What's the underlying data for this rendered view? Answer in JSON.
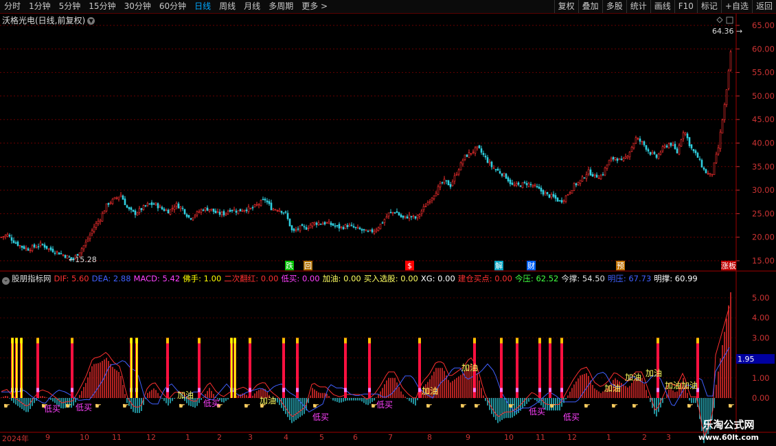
{
  "toolbar": {
    "periods": [
      "分时",
      "1分钟",
      "5分钟",
      "15分钟",
      "30分钟",
      "60分钟",
      "日线",
      "周线",
      "月线",
      "多周期",
      "更多 >"
    ],
    "active": "日线",
    "right": [
      "复权",
      "叠加",
      "多股",
      "统计",
      "画线",
      "F10",
      "标记",
      "+自选",
      "返回"
    ]
  },
  "stock": {
    "title": "沃格光电(日线,前复权)"
  },
  "main_chart": {
    "y_ticks": [
      "65.00",
      "60.00",
      "55.00",
      "50.00",
      "45.00",
      "40.00",
      "35.00",
      "30.00",
      "25.00",
      "20.00",
      "15.00"
    ],
    "high_label": "64.36",
    "low_label": "15.28",
    "event_markers": [
      {
        "text": "跌",
        "color": "#00c000"
      },
      {
        "text": "回",
        "color": "#b07000"
      },
      {
        "text": "$",
        "color": "#ff0000"
      },
      {
        "text": "解",
        "color": "#00a0c0"
      },
      {
        "text": "财",
        "color": "#0060ff"
      },
      {
        "text": "预",
        "color": "#c07000"
      },
      {
        "text": "涨板",
        "color": "#c00000"
      }
    ]
  },
  "indicator": {
    "name": "股朋指标网",
    "fields": [
      {
        "label": "DIF: 5.60",
        "color": "#ff3030"
      },
      {
        "label": "DEA: 2.88",
        "color": "#4060ff"
      },
      {
        "label": "MACD: 5.42",
        "color": "#ff40ff"
      },
      {
        "label": "佛手: 1.00",
        "color": "#ffff00"
      },
      {
        "label": "二次翻红: 0.00",
        "color": "#ff3030"
      },
      {
        "label": "低买: 0.00",
        "color": "#ff40ff"
      },
      {
        "label": "加油: 0.00",
        "color": "#ffff60"
      },
      {
        "label": "买入选股: 0.00",
        "color": "#ffff60"
      },
      {
        "label": "XG: 0.00",
        "color": "#ffffff"
      },
      {
        "label": "建仓买点: 0.00",
        "color": "#ff3030"
      },
      {
        "label": "今压: 62.52",
        "color": "#40ff40"
      },
      {
        "label": "今撑: 54.50",
        "color": "#e0e0e0"
      },
      {
        "label": "明压: 67.73",
        "color": "#4060ff"
      },
      {
        "label": "明撑: 60.99",
        "color": "#ffffff"
      }
    ],
    "y_ticks": [
      "5.00",
      "4.00",
      "3.00",
      "2.00",
      "1.00",
      "0.00"
    ],
    "current_value": "1.95",
    "signal_labels": [
      "低买",
      "低买",
      "加油",
      "低买",
      "加油",
      "低买",
      "低买",
      "加油",
      "加油",
      "低买",
      "低买",
      "加油",
      "加油",
      "加油",
      "加油",
      "加油"
    ]
  },
  "date_axis": [
    "2024年",
    "9",
    "10",
    "11",
    "12",
    "1",
    "2",
    "3",
    "4",
    "5",
    "6",
    "7",
    "8",
    "9",
    "10",
    "11",
    "12",
    "1",
    "2",
    "3"
  ],
  "watermark": {
    "line1": "乐淘公式网",
    "line2": "www.60lt.com"
  },
  "chart_data": {
    "type": "candlestick",
    "title": "沃格光电(日线,前复权)",
    "ylim": [
      13,
      67
    ],
    "price_path": [
      [
        0,
        20
      ],
      [
        10,
        20.5
      ],
      [
        20,
        19
      ],
      [
        30,
        18
      ],
      [
        40,
        17.5
      ],
      [
        50,
        18
      ],
      [
        60,
        18.5
      ],
      [
        70,
        17.5
      ],
      [
        80,
        17
      ],
      [
        95,
        16
      ],
      [
        105,
        15.28
      ],
      [
        115,
        17
      ],
      [
        125,
        19
      ],
      [
        135,
        22
      ],
      [
        145,
        24
      ],
      [
        155,
        27
      ],
      [
        165,
        28
      ],
      [
        175,
        29
      ],
      [
        185,
        26
      ],
      [
        195,
        25
      ],
      [
        205,
        26
      ],
      [
        215,
        27
      ],
      [
        225,
        27
      ],
      [
        235,
        26
      ],
      [
        245,
        25.5
      ],
      [
        255,
        27
      ],
      [
        265,
        26
      ],
      [
        275,
        24
      ],
      [
        285,
        25
      ],
      [
        295,
        26
      ],
      [
        305,
        26
      ],
      [
        315,
        25
      ],
      [
        325,
        25
      ],
      [
        335,
        26
      ],
      [
        345,
        25.5
      ],
      [
        355,
        26
      ],
      [
        365,
        26
      ],
      [
        375,
        27
      ],
      [
        385,
        28
      ],
      [
        395,
        26
      ],
      [
        405,
        26
      ],
      [
        415,
        25
      ],
      [
        425,
        21
      ],
      [
        435,
        22
      ],
      [
        445,
        22
      ],
      [
        455,
        23
      ],
      [
        465,
        23
      ],
      [
        475,
        23
      ],
      [
        485,
        22.5
      ],
      [
        495,
        22
      ],
      [
        505,
        22.5
      ],
      [
        515,
        22
      ],
      [
        525,
        21.5
      ],
      [
        535,
        21
      ],
      [
        545,
        21.5
      ],
      [
        555,
        23
      ],
      [
        565,
        25
      ],
      [
        575,
        25.5
      ],
      [
        585,
        24
      ],
      [
        595,
        24.5
      ],
      [
        605,
        24
      ],
      [
        615,
        26
      ],
      [
        625,
        28
      ],
      [
        635,
        30
      ],
      [
        645,
        32
      ],
      [
        655,
        31
      ],
      [
        665,
        34
      ],
      [
        675,
        37
      ],
      [
        685,
        38
      ],
      [
        695,
        39
      ],
      [
        705,
        37
      ],
      [
        715,
        35
      ],
      [
        725,
        34
      ],
      [
        735,
        33
      ],
      [
        745,
        31
      ],
      [
        755,
        31
      ],
      [
        765,
        31.5
      ],
      [
        775,
        31
      ],
      [
        785,
        30
      ],
      [
        795,
        29
      ],
      [
        805,
        28.5
      ],
      [
        815,
        27.5
      ],
      [
        825,
        29
      ],
      [
        835,
        31
      ],
      [
        845,
        32
      ],
      [
        855,
        34
      ],
      [
        865,
        33
      ],
      [
        875,
        33
      ],
      [
        885,
        36
      ],
      [
        895,
        37
      ],
      [
        905,
        36
      ],
      [
        915,
        38
      ],
      [
        925,
        41
      ],
      [
        935,
        40
      ],
      [
        945,
        38
      ],
      [
        955,
        37
      ],
      [
        965,
        39
      ],
      [
        975,
        40
      ],
      [
        985,
        38
      ],
      [
        995,
        43
      ],
      [
        1005,
        39
      ],
      [
        1015,
        37
      ],
      [
        1025,
        34
      ],
      [
        1035,
        33
      ],
      [
        1045,
        39
      ],
      [
        1052,
        46
      ],
      [
        1058,
        52
      ],
      [
        1062,
        58
      ],
      [
        1065,
        62
      ]
    ],
    "signal_bar_x": [
      18,
      24,
      31,
      55,
      105,
      191,
      199,
      244,
      290,
      337,
      342,
      364,
      413,
      433,
      503,
      538,
      611,
      691,
      730,
      753,
      786,
      801,
      818,
      958,
      1016
    ],
    "yellow_bar_x": [
      18,
      24,
      31,
      191,
      199,
      337,
      342
    ],
    "macd_series": [
      {
        "name": "DIF",
        "color": "#ff3030"
      },
      {
        "name": "DEA",
        "color": "#4060ff"
      }
    ]
  }
}
